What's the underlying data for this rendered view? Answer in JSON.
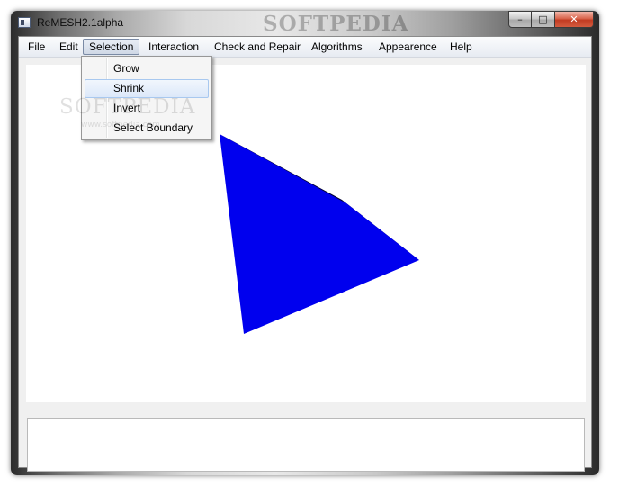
{
  "window": {
    "title": "ReMESH2.1alpha",
    "watermark": "SOFTPEDIA",
    "watermark_small": "www.softpedia.com",
    "caption_buttons": {
      "minimize": "–",
      "maximize": "□",
      "close": "✕"
    }
  },
  "menubar": {
    "items": [
      {
        "label": "File"
      },
      {
        "label": "Edit"
      },
      {
        "label": "Selection",
        "open": true
      },
      {
        "label": "Interaction"
      },
      {
        "label": "Check and Repair"
      },
      {
        "label": "Algorithms"
      },
      {
        "label": "Appearence"
      },
      {
        "label": "Help"
      }
    ]
  },
  "selection_menu": {
    "items": [
      {
        "label": "Grow"
      },
      {
        "label": "Shrink",
        "highlighted": true
      },
      {
        "label": "Invert"
      },
      {
        "label": "Select Boundary"
      }
    ]
  },
  "viewport": {
    "mesh_color": "#0000ee",
    "mesh_shadow_color": "#000033",
    "background": "#ffffff"
  }
}
